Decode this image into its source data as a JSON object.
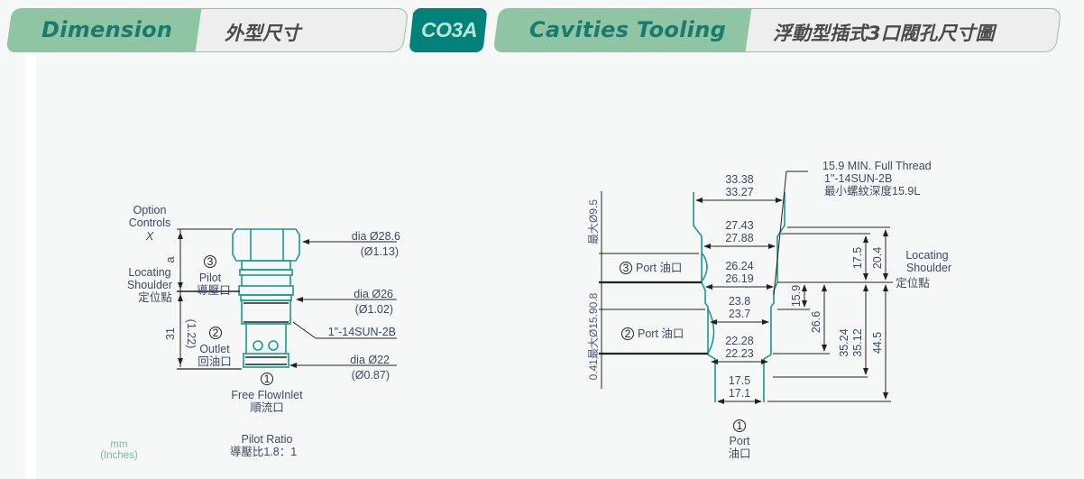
{
  "header": {
    "dimension": {
      "en": "Dimension",
      "zh": "外型尺寸"
    },
    "model": "CO3A",
    "cavities": {
      "en": "Cavities Tooling",
      "zh": "浮動型插式3口閥孔尺寸圖"
    }
  },
  "colors": {
    "tab_green": "#8fc5a2",
    "tab_text": "#1a7a6e",
    "badge": "#00827a",
    "outline_teal": "#1a9a8c",
    "dim_text": "#3c4a66"
  },
  "valve": {
    "option_controls": [
      "Option",
      "Controls",
      "X"
    ],
    "dim_a": "a",
    "locating_shoulder": [
      "Locating",
      "Shoulder",
      "定位點"
    ],
    "port3": {
      "num": "3",
      "en": "Pilot",
      "zh": "導壓口"
    },
    "port2": {
      "num": "2",
      "en": "Outlet",
      "zh": "回油口"
    },
    "port1": {
      "num": "1",
      "en": "Free FlowInlet",
      "zh": "順流口"
    },
    "length_mm": "31",
    "length_in": "(1.22)",
    "dia_top": {
      "mm": "dia  Ø28.6",
      "in": "(Ø1.13)"
    },
    "dia_mid": {
      "mm": "dia  Ø26",
      "in": "(Ø1.02)"
    },
    "thread": "1\"-14SUN-2B",
    "dia_bottom": {
      "mm": "dia  Ø22",
      "in": "(Ø0.87)"
    },
    "pilot_ratio": {
      "label": "Pilot Ratio",
      "value": "導壓比1.8：1"
    },
    "units": {
      "mm": "mm",
      "inches": "(Inches)"
    }
  },
  "cavity": {
    "thread_note": [
      "15.9 MIN. Full Thread",
      "1\"-14SUN-2B",
      "最小螺紋深度15.9L"
    ],
    "widths": [
      [
        "33.38",
        "33.27"
      ],
      [
        "27.43",
        "27.88"
      ],
      [
        "26.24",
        "26.19"
      ],
      [
        "23.8",
        "23.7"
      ],
      [
        "22.28",
        "22.23"
      ],
      [
        "17.5",
        "17.1"
      ]
    ],
    "port3": {
      "num": "3",
      "label": "Port 油口"
    },
    "port2": {
      "num": "2",
      "label": "Port 油口"
    },
    "port1": {
      "num": "1",
      "en": "Port",
      "zh": "油口"
    },
    "left_dim_top": "最大Ø9.5",
    "left_dim_bottom": "0.41最大Ø15.90.8",
    "depths": {
      "d17_5": "17.5",
      "d20_4": "20.4",
      "d15_9": "15.9",
      "d26_6": "26.6",
      "d35": [
        "35.24",
        "35.12"
      ],
      "d44_5": "44.5"
    },
    "locating_shoulder": [
      "Locating",
      "Shoulder",
      "定位點"
    ]
  }
}
